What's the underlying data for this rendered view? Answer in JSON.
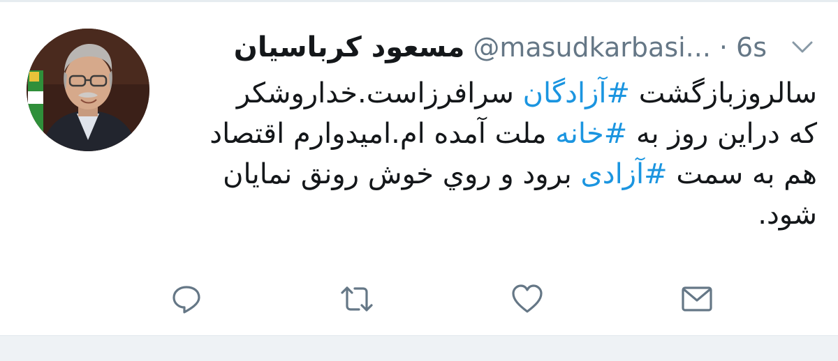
{
  "tweet": {
    "display_name": "مسعود کرباسیان",
    "handle": "@masudkarbasi...",
    "separator": "·",
    "timestamp": "6s",
    "lines": [
      [
        {
          "t": "سالروزبازگشت "
        },
        {
          "t": "#آزادگان",
          "tag": true
        },
        {
          "t": " سرافرزاست.خداروشکر"
        }
      ],
      [
        {
          "t": "که دراین روز به "
        },
        {
          "t": "#خانه",
          "tag": true
        },
        {
          "t": " ملت آمده ام.امیدوارم اقتصاد"
        }
      ],
      [
        {
          "t": "هم به سمت "
        },
        {
          "t": "#آزادی",
          "tag": true
        },
        {
          "t": " برود و روي خوش رونق نمايان"
        }
      ],
      [
        {
          "t": "شود."
        }
      ]
    ]
  },
  "actions": [
    {
      "name": "reply-icon"
    },
    {
      "name": "retweet-icon"
    },
    {
      "name": "like-icon"
    },
    {
      "name": "direct-message-icon"
    }
  ],
  "colors": {
    "text": "#14171a",
    "muted": "#657786",
    "hashtag": "#1b95e0",
    "band": "#eef2f5"
  }
}
